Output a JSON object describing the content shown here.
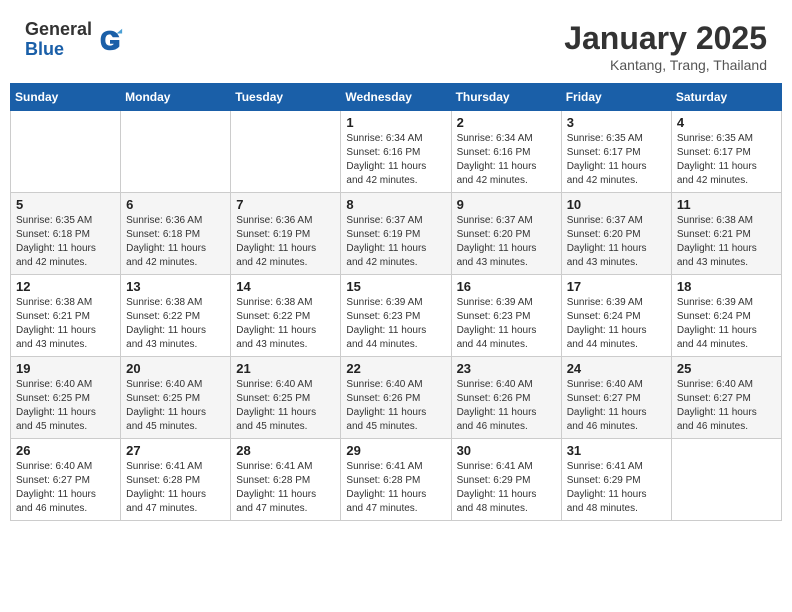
{
  "header": {
    "logo_general": "General",
    "logo_blue": "Blue",
    "month_title": "January 2025",
    "location": "Kantang, Trang, Thailand"
  },
  "days_of_week": [
    "Sunday",
    "Monday",
    "Tuesday",
    "Wednesday",
    "Thursday",
    "Friday",
    "Saturday"
  ],
  "weeks": [
    [
      {
        "day": "",
        "info": ""
      },
      {
        "day": "",
        "info": ""
      },
      {
        "day": "",
        "info": ""
      },
      {
        "day": "1",
        "info": "Sunrise: 6:34 AM\nSunset: 6:16 PM\nDaylight: 11 hours\nand 42 minutes."
      },
      {
        "day": "2",
        "info": "Sunrise: 6:34 AM\nSunset: 6:16 PM\nDaylight: 11 hours\nand 42 minutes."
      },
      {
        "day": "3",
        "info": "Sunrise: 6:35 AM\nSunset: 6:17 PM\nDaylight: 11 hours\nand 42 minutes."
      },
      {
        "day": "4",
        "info": "Sunrise: 6:35 AM\nSunset: 6:17 PM\nDaylight: 11 hours\nand 42 minutes."
      }
    ],
    [
      {
        "day": "5",
        "info": "Sunrise: 6:35 AM\nSunset: 6:18 PM\nDaylight: 11 hours\nand 42 minutes."
      },
      {
        "day": "6",
        "info": "Sunrise: 6:36 AM\nSunset: 6:18 PM\nDaylight: 11 hours\nand 42 minutes."
      },
      {
        "day": "7",
        "info": "Sunrise: 6:36 AM\nSunset: 6:19 PM\nDaylight: 11 hours\nand 42 minutes."
      },
      {
        "day": "8",
        "info": "Sunrise: 6:37 AM\nSunset: 6:19 PM\nDaylight: 11 hours\nand 42 minutes."
      },
      {
        "day": "9",
        "info": "Sunrise: 6:37 AM\nSunset: 6:20 PM\nDaylight: 11 hours\nand 43 minutes."
      },
      {
        "day": "10",
        "info": "Sunrise: 6:37 AM\nSunset: 6:20 PM\nDaylight: 11 hours\nand 43 minutes."
      },
      {
        "day": "11",
        "info": "Sunrise: 6:38 AM\nSunset: 6:21 PM\nDaylight: 11 hours\nand 43 minutes."
      }
    ],
    [
      {
        "day": "12",
        "info": "Sunrise: 6:38 AM\nSunset: 6:21 PM\nDaylight: 11 hours\nand 43 minutes."
      },
      {
        "day": "13",
        "info": "Sunrise: 6:38 AM\nSunset: 6:22 PM\nDaylight: 11 hours\nand 43 minutes."
      },
      {
        "day": "14",
        "info": "Sunrise: 6:38 AM\nSunset: 6:22 PM\nDaylight: 11 hours\nand 43 minutes."
      },
      {
        "day": "15",
        "info": "Sunrise: 6:39 AM\nSunset: 6:23 PM\nDaylight: 11 hours\nand 44 minutes."
      },
      {
        "day": "16",
        "info": "Sunrise: 6:39 AM\nSunset: 6:23 PM\nDaylight: 11 hours\nand 44 minutes."
      },
      {
        "day": "17",
        "info": "Sunrise: 6:39 AM\nSunset: 6:24 PM\nDaylight: 11 hours\nand 44 minutes."
      },
      {
        "day": "18",
        "info": "Sunrise: 6:39 AM\nSunset: 6:24 PM\nDaylight: 11 hours\nand 44 minutes."
      }
    ],
    [
      {
        "day": "19",
        "info": "Sunrise: 6:40 AM\nSunset: 6:25 PM\nDaylight: 11 hours\nand 45 minutes."
      },
      {
        "day": "20",
        "info": "Sunrise: 6:40 AM\nSunset: 6:25 PM\nDaylight: 11 hours\nand 45 minutes."
      },
      {
        "day": "21",
        "info": "Sunrise: 6:40 AM\nSunset: 6:25 PM\nDaylight: 11 hours\nand 45 minutes."
      },
      {
        "day": "22",
        "info": "Sunrise: 6:40 AM\nSunset: 6:26 PM\nDaylight: 11 hours\nand 45 minutes."
      },
      {
        "day": "23",
        "info": "Sunrise: 6:40 AM\nSunset: 6:26 PM\nDaylight: 11 hours\nand 46 minutes."
      },
      {
        "day": "24",
        "info": "Sunrise: 6:40 AM\nSunset: 6:27 PM\nDaylight: 11 hours\nand 46 minutes."
      },
      {
        "day": "25",
        "info": "Sunrise: 6:40 AM\nSunset: 6:27 PM\nDaylight: 11 hours\nand 46 minutes."
      }
    ],
    [
      {
        "day": "26",
        "info": "Sunrise: 6:40 AM\nSunset: 6:27 PM\nDaylight: 11 hours\nand 46 minutes."
      },
      {
        "day": "27",
        "info": "Sunrise: 6:41 AM\nSunset: 6:28 PM\nDaylight: 11 hours\nand 47 minutes."
      },
      {
        "day": "28",
        "info": "Sunrise: 6:41 AM\nSunset: 6:28 PM\nDaylight: 11 hours\nand 47 minutes."
      },
      {
        "day": "29",
        "info": "Sunrise: 6:41 AM\nSunset: 6:28 PM\nDaylight: 11 hours\nand 47 minutes."
      },
      {
        "day": "30",
        "info": "Sunrise: 6:41 AM\nSunset: 6:29 PM\nDaylight: 11 hours\nand 48 minutes."
      },
      {
        "day": "31",
        "info": "Sunrise: 6:41 AM\nSunset: 6:29 PM\nDaylight: 11 hours\nand 48 minutes."
      },
      {
        "day": "",
        "info": ""
      }
    ]
  ]
}
